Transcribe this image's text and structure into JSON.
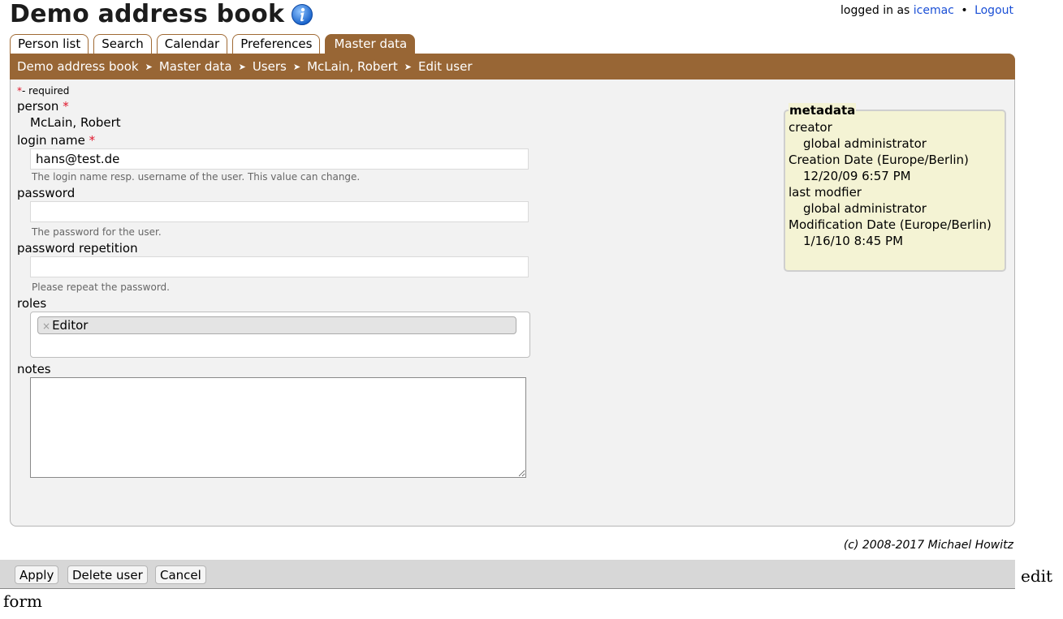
{
  "header": {
    "title": "Demo address book",
    "logged_in_prefix": "logged in as",
    "user": "icemac",
    "separator": "•",
    "logout": "Logout"
  },
  "tabs": [
    "Person list",
    "Search",
    "Calendar",
    "Preferences",
    "Master data"
  ],
  "active_tab": "Master data",
  "breadcrumb": {
    "items": [
      "Demo address book",
      "Master data",
      "Users",
      "McLain, Robert",
      "Edit user"
    ],
    "separator": "➤"
  },
  "form": {
    "required_note": "- required",
    "required_star": "*",
    "person_label": "person",
    "person_value": "McLain, Robert",
    "login_label": "login name",
    "login_value": "hans@test.de",
    "login_hint": "The login name resp. username of the user. This value can change.",
    "password_label": "password",
    "password_value": "",
    "password_hint": "The password for the user.",
    "password_rep_label": "password repetition",
    "password_rep_value": "",
    "password_rep_hint": "Please repeat the password.",
    "roles_label": "roles",
    "role_remove": "×",
    "roles": [
      "Editor"
    ],
    "notes_label": "notes",
    "notes_value": ""
  },
  "metadata": {
    "legend": "metadata",
    "creator_label": "creator",
    "creator_value": "global administrator",
    "creation_label": "Creation Date (Europe/Berlin)",
    "creation_value": "12/20/09 6:57 PM",
    "modifier_label": "last modfier",
    "modifier_value": "global administrator",
    "modification_label": "Modification Date (Europe/Berlin)",
    "modification_value": "1/16/10 8:45 PM"
  },
  "copyright": "(c) 2008-2017 Michael Howitz",
  "buttons": {
    "apply": "Apply",
    "delete": "Delete user",
    "cancel": "Cancel"
  },
  "caption": {
    "line1": "edit",
    "line2": "form"
  },
  "colors": {
    "accent": "#986635",
    "link": "#1a4fd6",
    "required": "#e0162b",
    "metadata_bg": "#f4f3d4"
  }
}
